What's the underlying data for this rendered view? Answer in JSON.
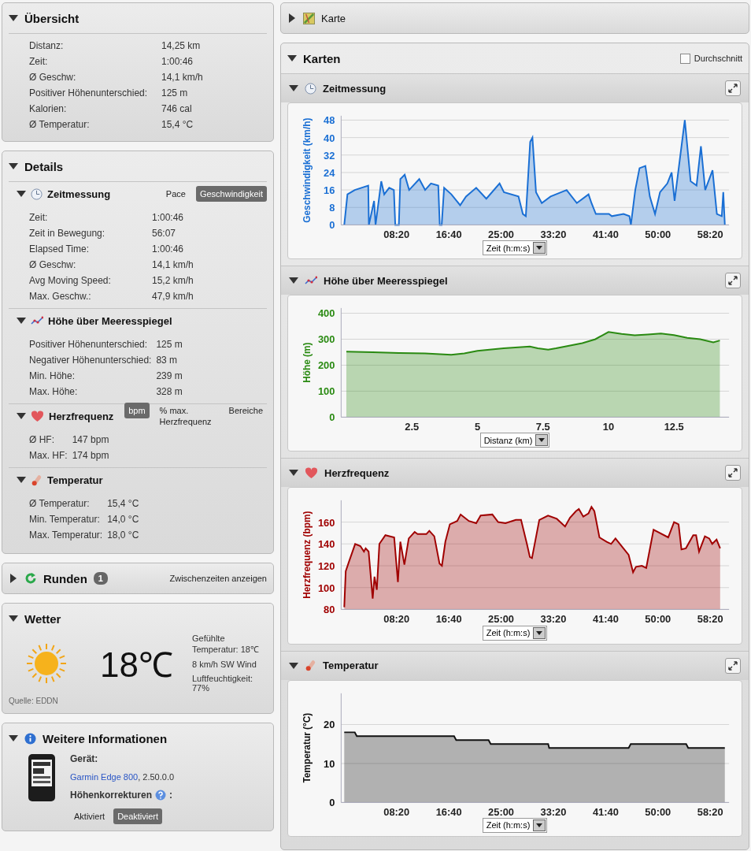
{
  "overview": {
    "title": "Übersicht",
    "expanded": true,
    "rows": [
      {
        "label": "Distanz:",
        "value": "14,25 km"
      },
      {
        "label": "Zeit:",
        "value": "1:00:46"
      },
      {
        "label": "Ø Geschw:",
        "value": "14,1 km/h"
      },
      {
        "label": "Positiver Höhenunterschied:",
        "value": "125 m"
      },
      {
        "label": "Kalorien:",
        "value": "746 cal"
      },
      {
        "label": "Ø Temperatur:",
        "value": "15,4 °C"
      }
    ]
  },
  "details": {
    "title": "Details",
    "expanded": true,
    "sections": [
      {
        "kind": "timing",
        "title": "Zeitmessung",
        "expanded": true,
        "toggles": [
          {
            "label": "Pace",
            "selected": false
          },
          {
            "label": "Geschwindigkeit",
            "selected": true
          }
        ],
        "rows": [
          {
            "label": "Zeit:",
            "value": "1:00:46"
          },
          {
            "label": "Zeit in Bewegung:",
            "value": "56:07"
          },
          {
            "label": "Elapsed Time:",
            "value": "1:00:46"
          },
          {
            "label": "Ø Geschw:",
            "value": "14,1 km/h"
          },
          {
            "label": "Avg Moving Speed:",
            "value": "15,2 km/h"
          },
          {
            "label": "Max. Geschw.:",
            "value": "47,9 km/h"
          }
        ]
      },
      {
        "kind": "elevation",
        "title": "Höhe über Meeresspiegel",
        "expanded": true,
        "rows": [
          {
            "label": "Positiver Höhenunterschied:",
            "value": "125 m"
          },
          {
            "label": "Negativer Höhenunterschied:",
            "value": "83 m"
          },
          {
            "label": "Min. Höhe:",
            "value": "239 m"
          },
          {
            "label": "Max. Höhe:",
            "value": "328 m"
          }
        ]
      },
      {
        "kind": "heart",
        "title": "Herzfrequenz",
        "expanded": true,
        "toggles": [
          {
            "label": "bpm",
            "selected": true
          },
          {
            "label": "% max. Herzfrequenz",
            "selected": false
          },
          {
            "label": "Bereiche",
            "selected": false
          }
        ],
        "rows": [
          {
            "label": "Ø HF:",
            "value": "147 bpm"
          },
          {
            "label": "Max. HF:",
            "value": "174 bpm"
          }
        ]
      },
      {
        "kind": "temperature",
        "title": "Temperatur",
        "expanded": true,
        "rows": [
          {
            "label": "Ø Temperatur:",
            "value": "15,4 °C"
          },
          {
            "label": "Min. Temperatur:",
            "value": "14,0 °C"
          },
          {
            "label": "Max. Temperatur:",
            "value": "18,0 °C"
          }
        ]
      }
    ]
  },
  "laps": {
    "title": "Runden",
    "expanded": false,
    "count": "1",
    "link": "Zwischenzeiten anzeigen"
  },
  "weather": {
    "title": "Wetter",
    "expanded": true,
    "temperature": "18℃",
    "details": [
      "Gefühlte Temperatur: 18℃",
      "8 km/h SW Wind",
      "Luftfeuchtigkeit: 77%"
    ],
    "source": "Quelle: EDDN"
  },
  "more_info": {
    "title": "Weitere Informationen",
    "expanded": true,
    "device_label": "Gerät:",
    "device_link": "Garmin Edge 800",
    "device_version": ", 2.50.0.0",
    "corrections_label": "Höhenkorrekturen",
    "corrections_colon": ":",
    "toggles": [
      {
        "label": "Aktiviert",
        "selected": false
      },
      {
        "label": "Deaktiviert",
        "selected": true
      }
    ]
  },
  "map": {
    "title": "Karte",
    "expanded": false
  },
  "charts_panel": {
    "title": "Karten",
    "expanded": true,
    "average": {
      "label": "Durchschnitt",
      "checked": false
    },
    "charts": [
      {
        "kind": "timing",
        "title": "Zeitmessung",
        "expanded": true,
        "chart_data": {
          "type": "area",
          "xlabel": "Zeit (h:m:s)",
          "ylabel": "Geschwindigkeit (km/h)",
          "xlim": [
            -30,
            3680
          ],
          "ylim": [
            0,
            50
          ],
          "yticks": [
            0,
            8,
            16,
            24,
            32,
            40,
            48
          ],
          "xticks": [
            {
              "value": 500,
              "label": "08:20"
            },
            {
              "value": 1000,
              "label": "16:40"
            },
            {
              "value": 1500,
              "label": "25:00"
            },
            {
              "value": 2000,
              "label": "33:20"
            },
            {
              "value": 2500,
              "label": "41:40"
            },
            {
              "value": 3000,
              "label": "50:00"
            },
            {
              "value": 3500,
              "label": "58:20"
            }
          ],
          "x": [
            0,
            30,
            100,
            229,
            235,
            285,
            299,
            354,
            382,
            430,
            474,
            488,
            522,
            536,
            578,
            620,
            717,
            773,
            829,
            899,
            913,
            932,
            955,
            1024,
            1108,
            1164,
            1262,
            1359,
            1485,
            1527,
            1666,
            1708,
            1736,
            1778,
            1800,
            1834,
            1889,
            1973,
            2127,
            2224,
            2336,
            2364,
            2406,
            2531,
            2559,
            2671,
            2727,
            2741,
            2783,
            2824,
            2880,
            2922,
            2972,
            3020,
            3090,
            3131,
            3159,
            3257,
            3313,
            3369,
            3411,
            3452,
            3522,
            3564,
            3611,
            3625,
            3640
          ],
          "grid": true,
          "series": [
            {
              "color": "#1a6fd4",
              "values": [
                0,
                14,
                16,
                18,
                0,
                11,
                0,
                20,
                14,
                17,
                16,
                0,
                0,
                21,
                23,
                16,
                21,
                16,
                19,
                18,
                0,
                0,
                17,
                14,
                9,
                13,
                17,
                12,
                19,
                15,
                13,
                5,
                4,
                38,
                40,
                15,
                10,
                13,
                16,
                10,
                14,
                10,
                5,
                5,
                4,
                5,
                4,
                0,
                16,
                26,
                27,
                13,
                5,
                15,
                19,
                24,
                11,
                48,
                20,
                18,
                36,
                16,
                25,
                5,
                4,
                15,
                0
              ]
            }
          ]
        }
      },
      {
        "kind": "elevation",
        "title": "Höhe über Meeresspiegel",
        "expanded": true,
        "chart_data": {
          "type": "area",
          "xlabel": "Distanz (km)",
          "ylabel": "Höhe (m)",
          "xlim": [
            -0.2,
            14.6
          ],
          "ylim": [
            0,
            420
          ],
          "yticks": [
            0,
            100,
            200,
            300,
            400
          ],
          "xticks": [
            2.5,
            5,
            7.5,
            10,
            12.5
          ],
          "x": [
            0,
            1,
            1.5,
            2,
            3,
            4,
            4.5,
            5,
            6,
            7,
            7.3,
            7.7,
            8,
            9,
            9.5,
            10,
            10.5,
            11,
            11.5,
            12,
            12.5,
            13,
            13.5,
            14,
            14.25
          ],
          "grid": true,
          "series": [
            {
              "color": "#2a8a12",
              "values": [
                252,
                250,
                248,
                247,
                245,
                240,
                245,
                255,
                265,
                272,
                265,
                260,
                265,
                285,
                300,
                328,
                320,
                315,
                318,
                322,
                316,
                305,
                300,
                288,
                295
              ]
            }
          ]
        }
      },
      {
        "kind": "heart",
        "title": "Herzfrequenz",
        "expanded": true,
        "chart_data": {
          "type": "area",
          "xlabel": "Zeit (h:m:s)",
          "ylabel": "Herzfrequenz (bpm)",
          "xlim": [
            -30,
            3680
          ],
          "ylim": [
            80,
            180
          ],
          "yticks": [
            80,
            100,
            120,
            140,
            160
          ],
          "xticks": [
            {
              "value": 500,
              "label": "08:20"
            },
            {
              "value": 1000,
              "label": "16:40"
            },
            {
              "value": 1500,
              "label": "25:00"
            },
            {
              "value": 2000,
              "label": "33:20"
            },
            {
              "value": 2500,
              "label": "41:40"
            },
            {
              "value": 3000,
              "label": "50:00"
            },
            {
              "value": 3500,
              "label": "58:20"
            }
          ],
          "x": [
            0,
            14,
            42,
            104,
            154,
            188,
            205,
            233,
            272,
            289,
            311,
            336,
            393,
            477,
            513,
            536,
            575,
            617,
            673,
            701,
            785,
            813,
            861,
            911,
            934,
            967,
            1010,
            1080,
            1113,
            1192,
            1262,
            1304,
            1416,
            1472,
            1542,
            1640,
            1691,
            1747,
            1775,
            1795,
            1865,
            1949,
            2033,
            2112,
            2159,
            2215,
            2244,
            2286,
            2336,
            2364,
            2392,
            2440,
            2510,
            2552,
            2594,
            2636,
            2720,
            2762,
            2790,
            2846,
            2888,
            2958,
            3000,
            3098,
            3154,
            3197,
            3225,
            3267,
            3337,
            3365,
            3393,
            3449,
            3491,
            3519,
            3561,
            3595
          ],
          "grid": true,
          "series": [
            {
              "color": "#a00000",
              "values": [
                82,
                115,
                123,
                140,
                138,
                133,
                136,
                133,
                90,
                110,
                98,
                140,
                148,
                146,
                105,
                142,
                121,
                145,
                151,
                149,
                149,
                152,
                147,
                122,
                120,
                142,
                158,
                161,
                167,
                161,
                159,
                166,
                167,
                160,
                159,
                162,
                162,
                140,
                128,
                127,
                162,
                166,
                163,
                156,
                164,
                170,
                172,
                165,
                168,
                174,
                170,
                146,
                142,
                140,
                145,
                140,
                130,
                114,
                119,
                120,
                118,
                153,
                151,
                146,
                160,
                158,
                135,
                136,
                148,
                148,
                133,
                147,
                145,
                140,
                144,
                136
              ]
            }
          ]
        }
      },
      {
        "kind": "temperature",
        "title": "Temperatur",
        "expanded": true,
        "chart_data": {
          "type": "area",
          "xlabel": "Zeit (h:m:s)",
          "ylabel": "Temperatur (°C)",
          "xlim": [
            -30,
            3680
          ],
          "ylim": [
            0,
            28
          ],
          "yticks": [
            0,
            10,
            20
          ],
          "xticks": [
            {
              "value": 500,
              "label": "08:20"
            },
            {
              "value": 1000,
              "label": "16:40"
            },
            {
              "value": 1500,
              "label": "25:00"
            },
            {
              "value": 2000,
              "label": "33:20"
            },
            {
              "value": 2500,
              "label": "41:40"
            },
            {
              "value": 3000,
              "label": "50:00"
            },
            {
              "value": 3500,
              "label": "58:20"
            }
          ],
          "x": [
            0,
            100,
            120,
            1050,
            1070,
            1380,
            1400,
            1950,
            1960,
            2720,
            2740,
            3270,
            3290,
            3640
          ],
          "grid": true,
          "series": [
            {
              "color": "#111111",
              "values": [
                18,
                18,
                17,
                17,
                16,
                16,
                15,
                15,
                14,
                14,
                15,
                15,
                14,
                14
              ]
            }
          ]
        }
      }
    ]
  }
}
